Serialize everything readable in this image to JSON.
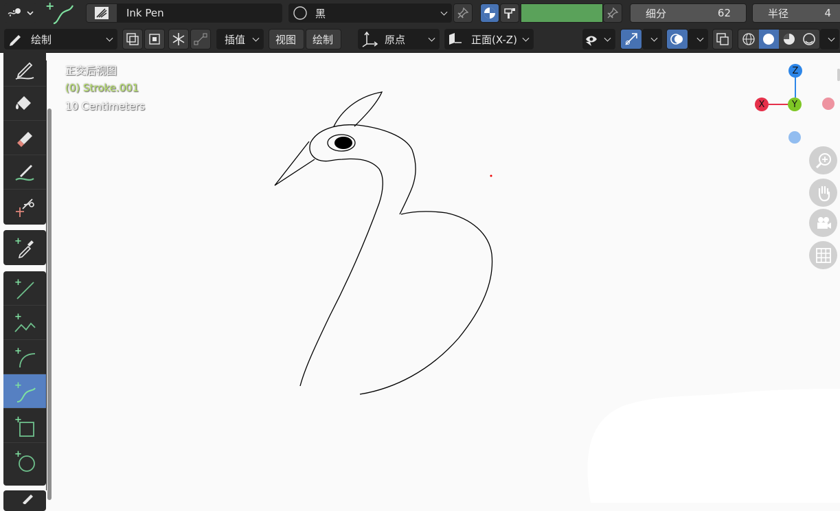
{
  "header": {
    "brush_name": "Ink Pen",
    "material_name": "黑",
    "subdivide_label": "细分",
    "subdivide_value": "62",
    "radius_label": "半径",
    "radius_value": "4"
  },
  "toolbar2": {
    "mode": "绘制",
    "interpolate": "插值",
    "view": "视图",
    "draw": "绘制",
    "origin": "原点",
    "plane": "正面(X-Z)"
  },
  "overlay": {
    "view_name": "正交后视图",
    "object": "(0) Stroke.001",
    "scale": "10 Centimeters"
  },
  "gizmo": {
    "x": "X",
    "y": "Y",
    "z": "Z"
  },
  "colors": {
    "accent": "#4772b3",
    "active_tool": "#5680c2",
    "object_text": "#b8e26a",
    "gizmo_x": "#e5304a",
    "gizmo_y": "#7ec625",
    "gizmo_z": "#2d86e8",
    "swatch_green": "#5aa25a"
  },
  "icons": {
    "editor_type": "grease-pencil-editor-icon",
    "brush": "ink-pen-icon",
    "material": "material-sphere-icon"
  }
}
